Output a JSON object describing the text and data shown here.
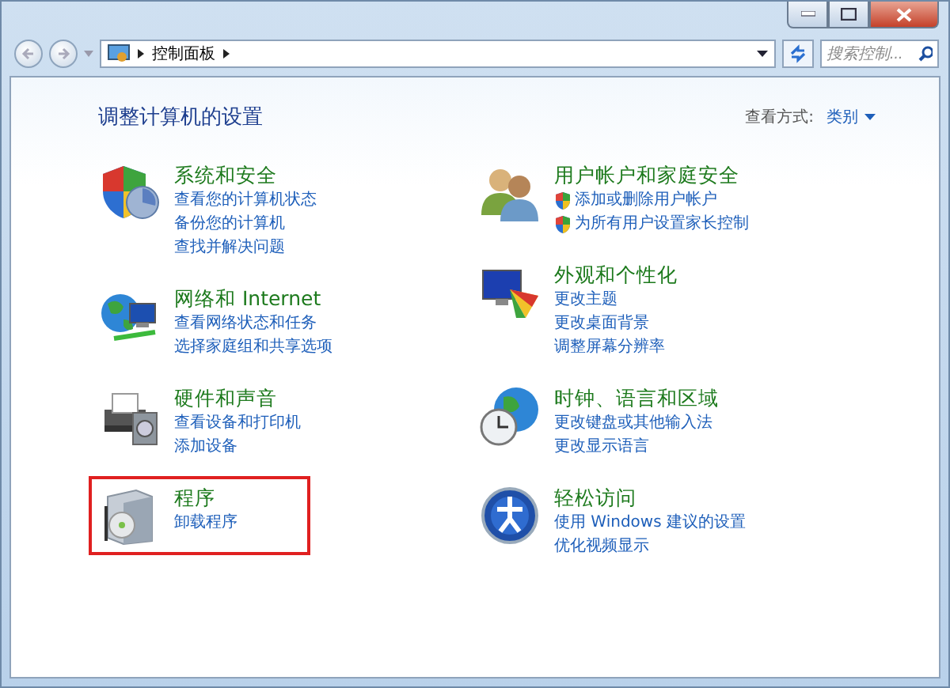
{
  "address_bar": {
    "crumbs": [
      "控制面板"
    ]
  },
  "search": {
    "placeholder": "搜索控制..."
  },
  "heading": "调整计算机的设置",
  "view_by": {
    "label": "查看方式:",
    "value": "类别"
  },
  "columns": [
    {
      "categories": [
        {
          "kind": "security",
          "title": "系统和安全",
          "highlighted": false,
          "links": [
            {
              "text": "查看您的计算机状态",
              "shield": false
            },
            {
              "text": "备份您的计算机",
              "shield": false
            },
            {
              "text": "查找并解决问题",
              "shield": false
            }
          ]
        },
        {
          "kind": "network",
          "title": "网络和 Internet",
          "highlighted": false,
          "links": [
            {
              "text": "查看网络状态和任务",
              "shield": false
            },
            {
              "text": "选择家庭组和共享选项",
              "shield": false
            }
          ]
        },
        {
          "kind": "hardware",
          "title": "硬件和声音",
          "highlighted": false,
          "links": [
            {
              "text": "查看设备和打印机",
              "shield": false
            },
            {
              "text": "添加设备",
              "shield": false
            }
          ]
        },
        {
          "kind": "programs",
          "title": "程序",
          "highlighted": true,
          "links": [
            {
              "text": "卸载程序",
              "shield": false
            }
          ]
        }
      ]
    },
    {
      "categories": [
        {
          "kind": "accounts",
          "title": "用户帐户和家庭安全",
          "highlighted": false,
          "links": [
            {
              "text": "添加或删除用户帐户",
              "shield": true
            },
            {
              "text": "为所有用户设置家长控制",
              "shield": true
            }
          ]
        },
        {
          "kind": "appearance",
          "title": "外观和个性化",
          "highlighted": false,
          "links": [
            {
              "text": "更改主题",
              "shield": false
            },
            {
              "text": "更改桌面背景",
              "shield": false
            },
            {
              "text": "调整屏幕分辨率",
              "shield": false
            }
          ]
        },
        {
          "kind": "clock",
          "title": "时钟、语言和区域",
          "highlighted": false,
          "links": [
            {
              "text": "更改键盘或其他输入法",
              "shield": false
            },
            {
              "text": "更改显示语言",
              "shield": false
            }
          ]
        },
        {
          "kind": "access",
          "title": "轻松访问",
          "highlighted": false,
          "links": [
            {
              "text": "使用 Windows 建议的设置",
              "shield": false
            },
            {
              "text": "优化视频显示",
              "shield": false
            }
          ]
        }
      ]
    }
  ]
}
